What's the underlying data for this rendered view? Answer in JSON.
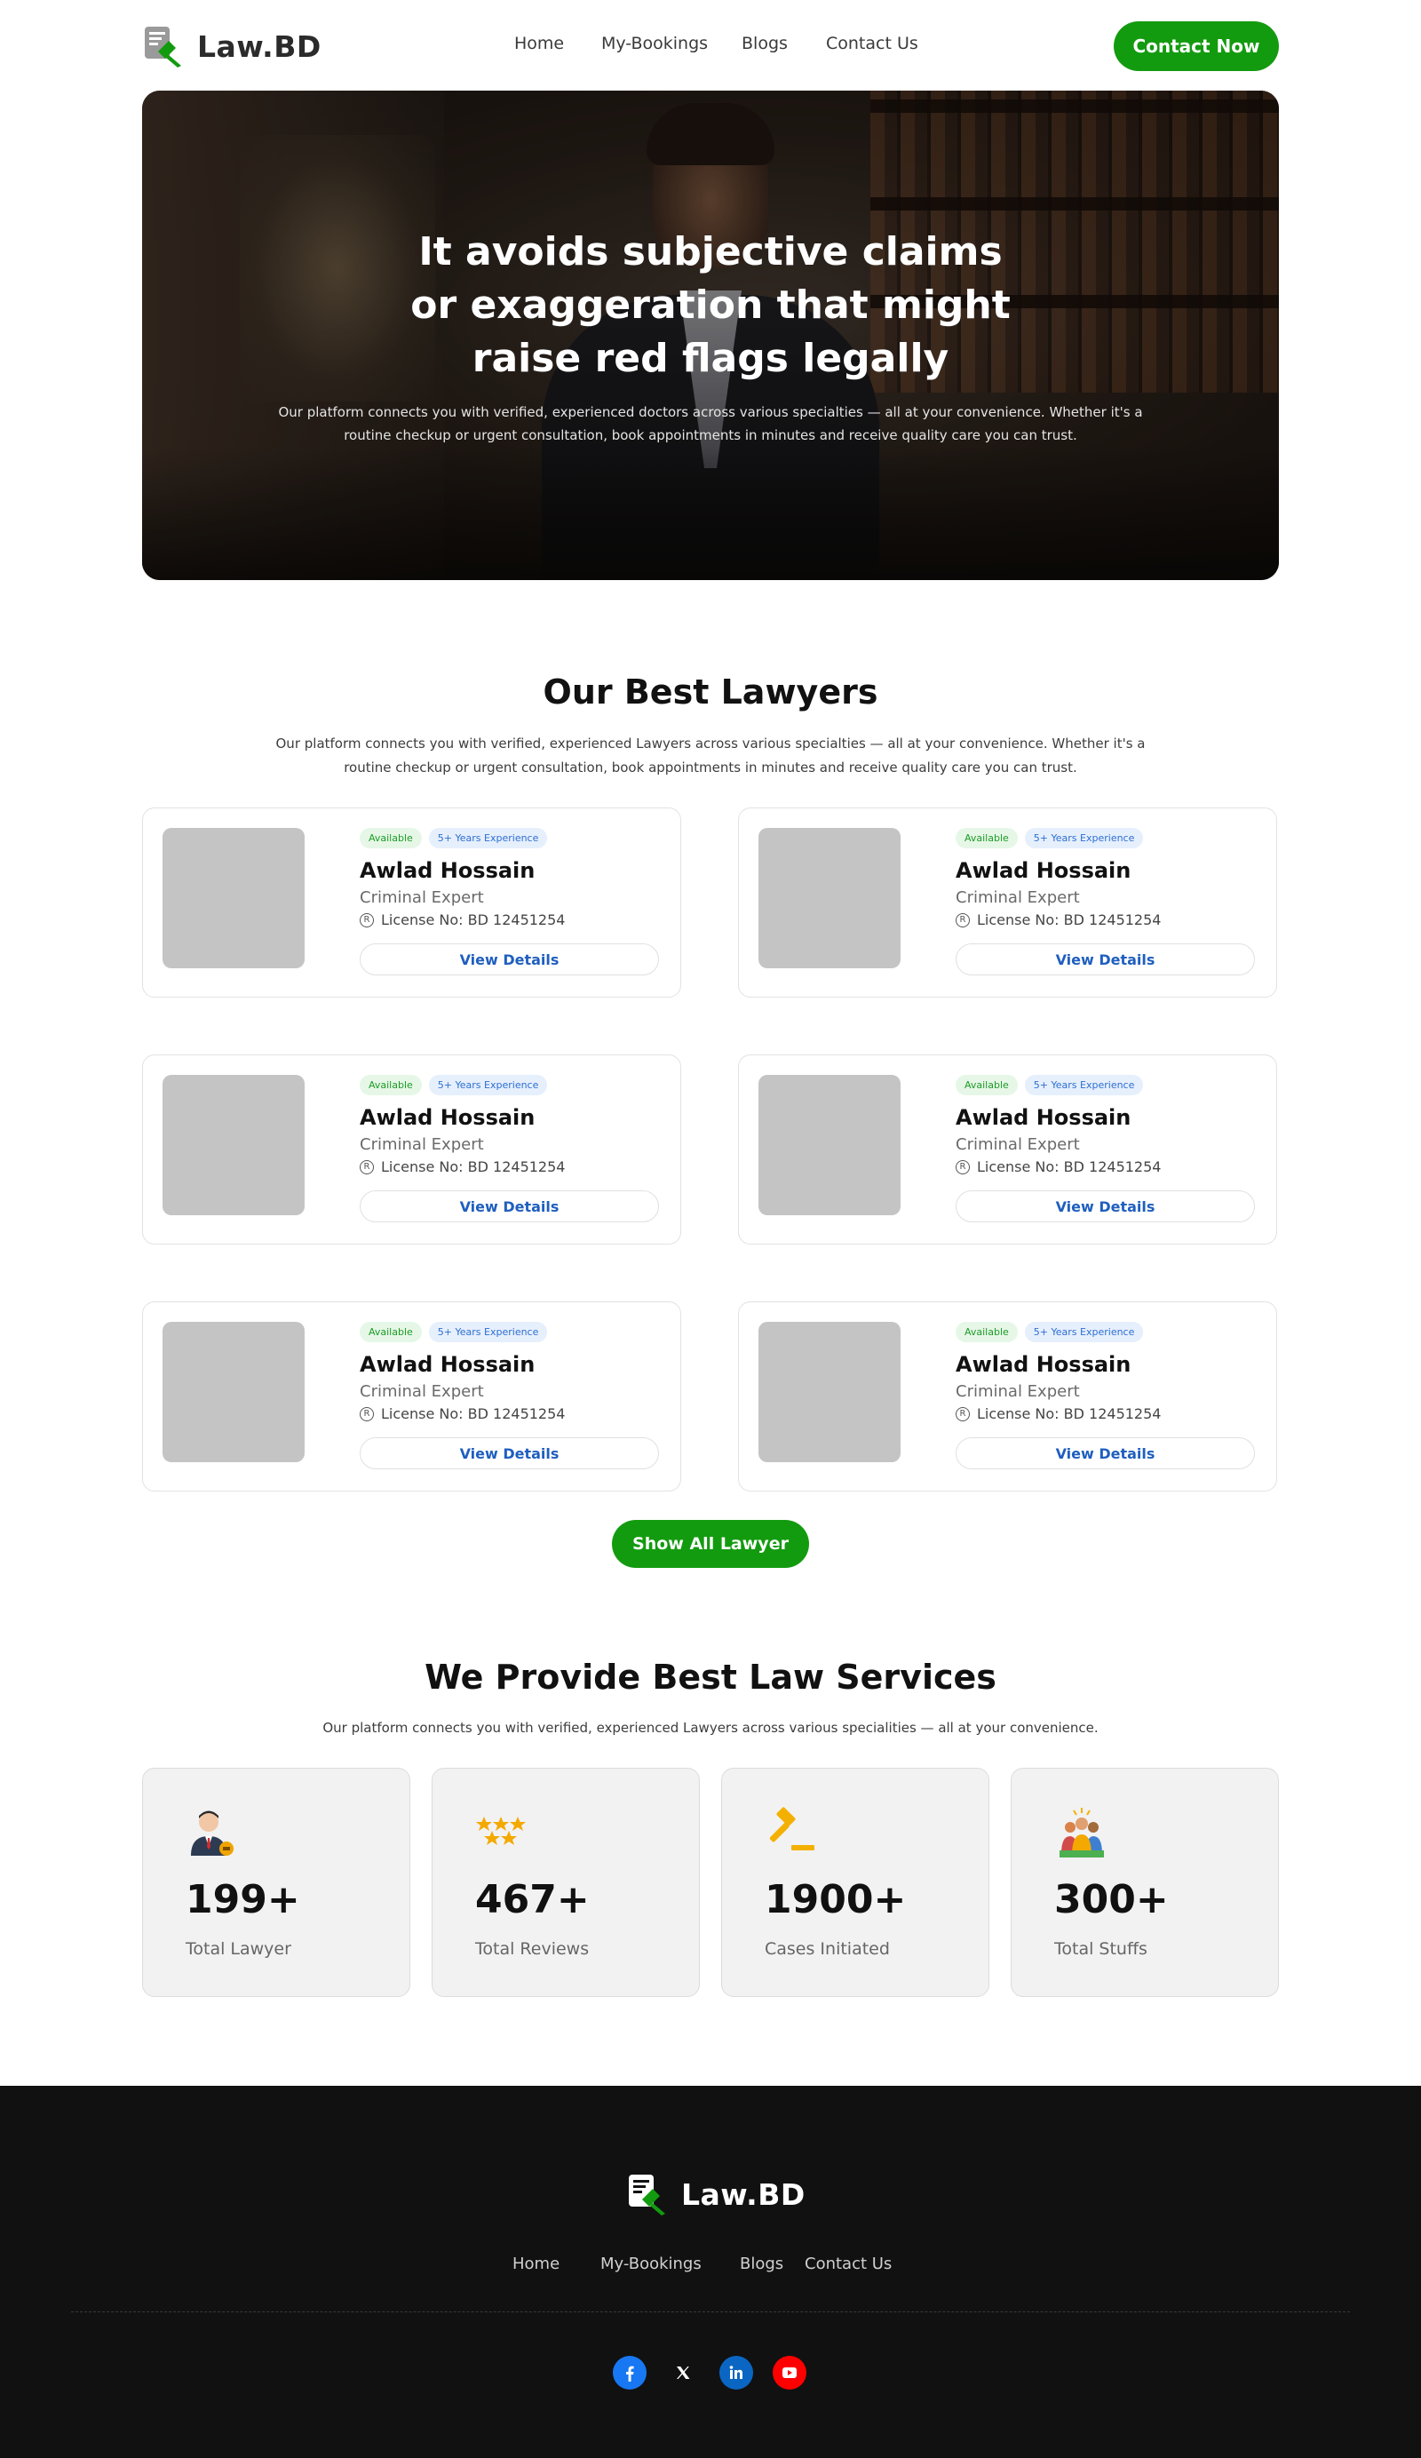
{
  "brand": {
    "name": "Law.BD"
  },
  "nav": {
    "links": [
      "Home",
      "My-Bookings",
      "Blogs",
      "Contact Us"
    ],
    "cta": "Contact Now"
  },
  "hero": {
    "title": "It avoids subjective claims or exaggeration that might raise red flags legally",
    "subtitle": "Our platform connects you with verified, experienced doctors across various specialties — all at your convenience. Whether it's a routine checkup or urgent consultation, book appointments in minutes and receive quality care you can trust."
  },
  "lawyers_section": {
    "title": "Our Best Lawyers",
    "description": "Our platform connects you with verified, experienced Lawyers across various specialties — all at your convenience. Whether it's a routine checkup or urgent consultation, book appointments in minutes and receive quality care you can trust.",
    "cards": [
      {
        "status": "Available",
        "experience": "5+ Years Experience",
        "name": "Awlad Hossain",
        "role": "Criminal Expert",
        "license": "License No: BD 12451254",
        "button": "View Details"
      },
      {
        "status": "Available",
        "experience": "5+ Years Experience",
        "name": "Awlad Hossain",
        "role": "Criminal Expert",
        "license": "License No: BD 12451254",
        "button": "View Details"
      },
      {
        "status": "Available",
        "experience": "5+ Years Experience",
        "name": "Awlad Hossain",
        "role": "Criminal Expert",
        "license": "License No: BD 12451254",
        "button": "View Details"
      },
      {
        "status": "Available",
        "experience": "5+ Years Experience",
        "name": "Awlad Hossain",
        "role": "Criminal Expert",
        "license": "License No: BD 12451254",
        "button": "View Details"
      },
      {
        "status": "Available",
        "experience": "5+ Years Experience",
        "name": "Awlad Hossain",
        "role": "Criminal Expert",
        "license": "License No: BD 12451254",
        "button": "View Details"
      },
      {
        "status": "Available",
        "experience": "5+ Years Experience",
        "name": "Awlad Hossain",
        "role": "Criminal Expert",
        "license": "License No: BD 12451254",
        "button": "View Details"
      }
    ],
    "show_all": "Show All Lawyer"
  },
  "services_section": {
    "title": "We Provide Best Law Services",
    "description": "Our platform connects you with verified, experienced Lawyers across various specialities — all at your convenience.",
    "stats": [
      {
        "icon": "lawyer-icon",
        "value": "199+",
        "label": "Total Lawyer"
      },
      {
        "icon": "stars-icon",
        "value": "467+",
        "label": "Total Reviews"
      },
      {
        "icon": "gavel-icon",
        "value": "1900+",
        "label": "Cases Initiated"
      },
      {
        "icon": "team-icon",
        "value": "300+",
        "label": "Total Stuffs"
      }
    ]
  },
  "footer": {
    "brand": "Law.BD",
    "links": [
      "Home",
      "My-Bookings",
      "Blogs",
      "Contact Us"
    ],
    "socials": [
      "facebook-icon",
      "x-icon",
      "linkedin-icon",
      "youtube-icon"
    ]
  },
  "colors": {
    "primary": "#139b0f",
    "footer_bg": "#111111",
    "link_blue": "#1f5fbf"
  }
}
